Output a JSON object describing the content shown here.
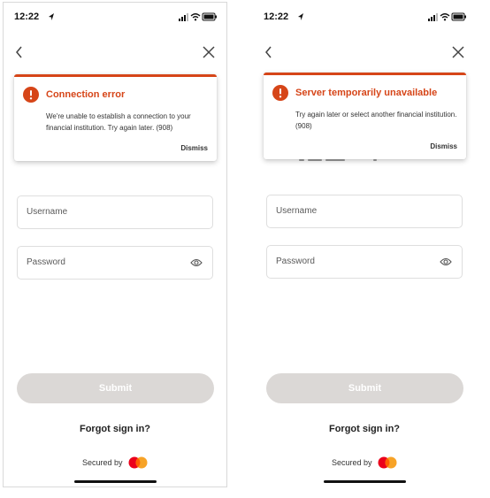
{
  "colors": {
    "error": "#d64518",
    "submit_disabled": "#dbd8d6",
    "mastercard_red": "#eb001b",
    "mastercard_orange": "#f79e1b"
  },
  "screens": [
    {
      "status": {
        "time": "12:22"
      },
      "error": {
        "title": "Connection error",
        "message": "We're unable to establish a connection to your financial institution. Try again later. (908)",
        "dismiss": "Dismiss"
      },
      "form": {
        "username_placeholder": "Username",
        "password_placeholder": "Password",
        "submit_label": "Submit"
      },
      "forgot_label": "Forgot sign in?",
      "secured_label": "Secured by"
    },
    {
      "status": {
        "time": "12:22"
      },
      "error": {
        "title": "Server temporarily unavailable",
        "message": "Try again later or select another financial institution. (908)",
        "dismiss": "Dismiss"
      },
      "form": {
        "username_placeholder": "Username",
        "password_placeholder": "Password",
        "submit_label": "Submit"
      },
      "forgot_label": "Forgot sign in?",
      "secured_label": "Secured by"
    }
  ]
}
